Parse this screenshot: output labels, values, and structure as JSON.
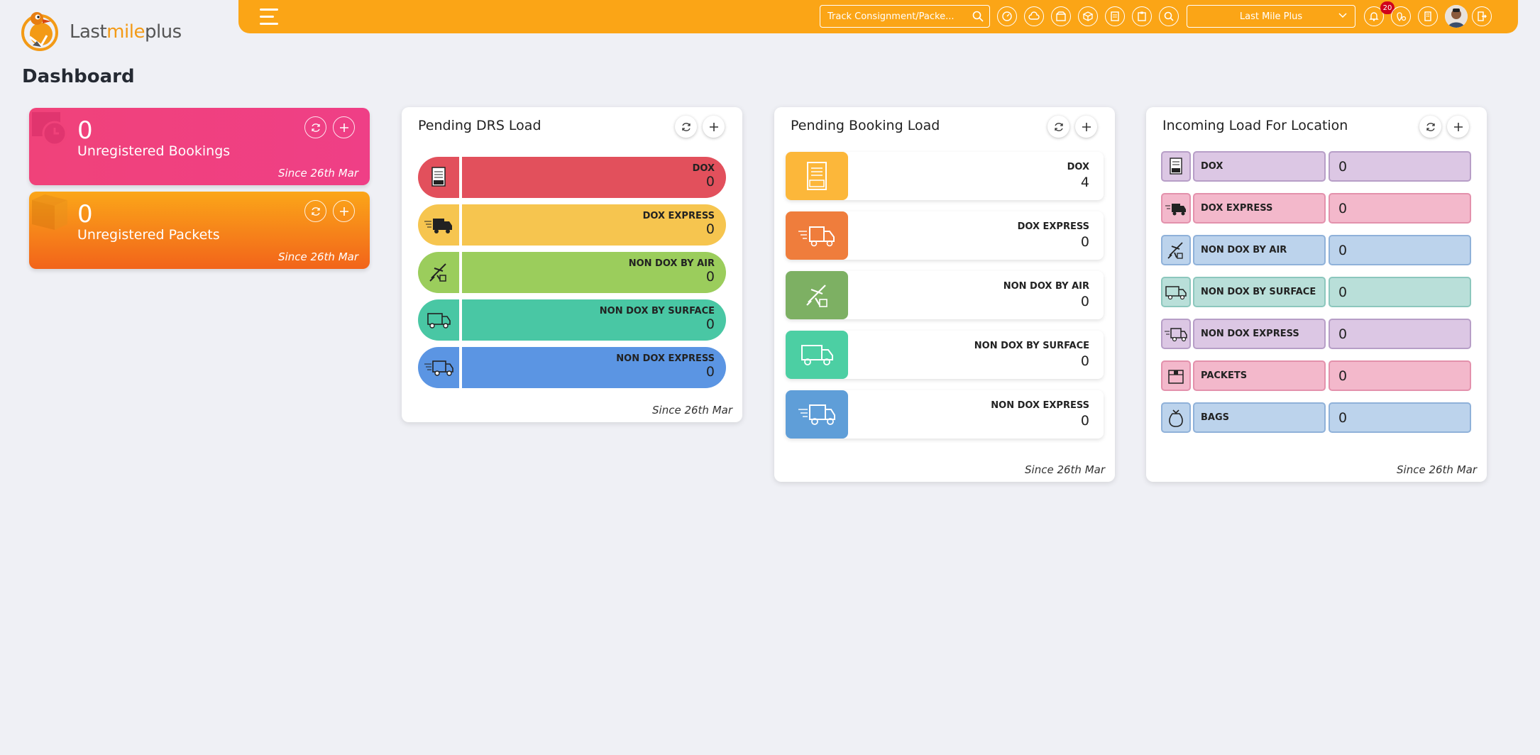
{
  "app": {
    "brand": {
      "part1": "Last",
      "part2": "mile",
      "part3": "plus"
    },
    "page_title": "Dashboard"
  },
  "topbar": {
    "track_placeholder": "Track Consignment/Packe...",
    "location_select": "Last Mile Plus",
    "notification_count": "20",
    "icons": [
      "dashboard-icon",
      "cloud-icon",
      "package-icon",
      "box-icon",
      "document-icon",
      "clipboard-icon",
      "search-icon"
    ],
    "accent_color": "#fba516"
  },
  "stats": [
    {
      "value": "0",
      "label": "Unregistered Bookings",
      "since": "Since 26th Mar",
      "color": "#f0427a"
    },
    {
      "value": "0",
      "label": "Unregistered Packets",
      "since": "Since 26th Mar",
      "color": "#f58a1a"
    }
  ],
  "drs": {
    "title": "Pending DRS Load",
    "since": "Since 26th Mar",
    "rows": [
      {
        "label": "DOX",
        "value": "0",
        "color": "#e2505c"
      },
      {
        "label": "DOX EXPRESS",
        "value": "0",
        "color": "#f6c54f"
      },
      {
        "label": "NON DOX BY AIR",
        "value": "0",
        "color": "#9bcd5c"
      },
      {
        "label": "NON DOX BY SURFACE",
        "value": "0",
        "color": "#49c7a4"
      },
      {
        "label": "NON DOX EXPRESS",
        "value": "0",
        "color": "#5b95e3"
      }
    ]
  },
  "booking": {
    "title": "Pending Booking Load",
    "since": "Since 26th Mar",
    "rows": [
      {
        "label": "DOX",
        "value": "4",
        "color": "#fcb73a"
      },
      {
        "label": "DOX EXPRESS",
        "value": "0",
        "color": "#ef7d3c"
      },
      {
        "label": "NON DOX BY AIR",
        "value": "0",
        "color": "#7db063"
      },
      {
        "label": "NON DOX BY SURFACE",
        "value": "0",
        "color": "#4ccfa3"
      },
      {
        "label": "NON DOX EXPRESS",
        "value": "0",
        "color": "#5f9ed8"
      }
    ]
  },
  "incoming": {
    "title": "Incoming Load For Location",
    "since": "Since 26th Mar",
    "rows": [
      {
        "label": "DOX",
        "value": "0"
      },
      {
        "label": "DOX EXPRESS",
        "value": "0"
      },
      {
        "label": "NON DOX BY AIR",
        "value": "0"
      },
      {
        "label": "NON DOX BY SURFACE",
        "value": "0"
      },
      {
        "label": "NON DOX EXPRESS",
        "value": "0"
      },
      {
        "label": "PACKETS",
        "value": "0"
      },
      {
        "label": "BAGS",
        "value": "0"
      }
    ]
  }
}
